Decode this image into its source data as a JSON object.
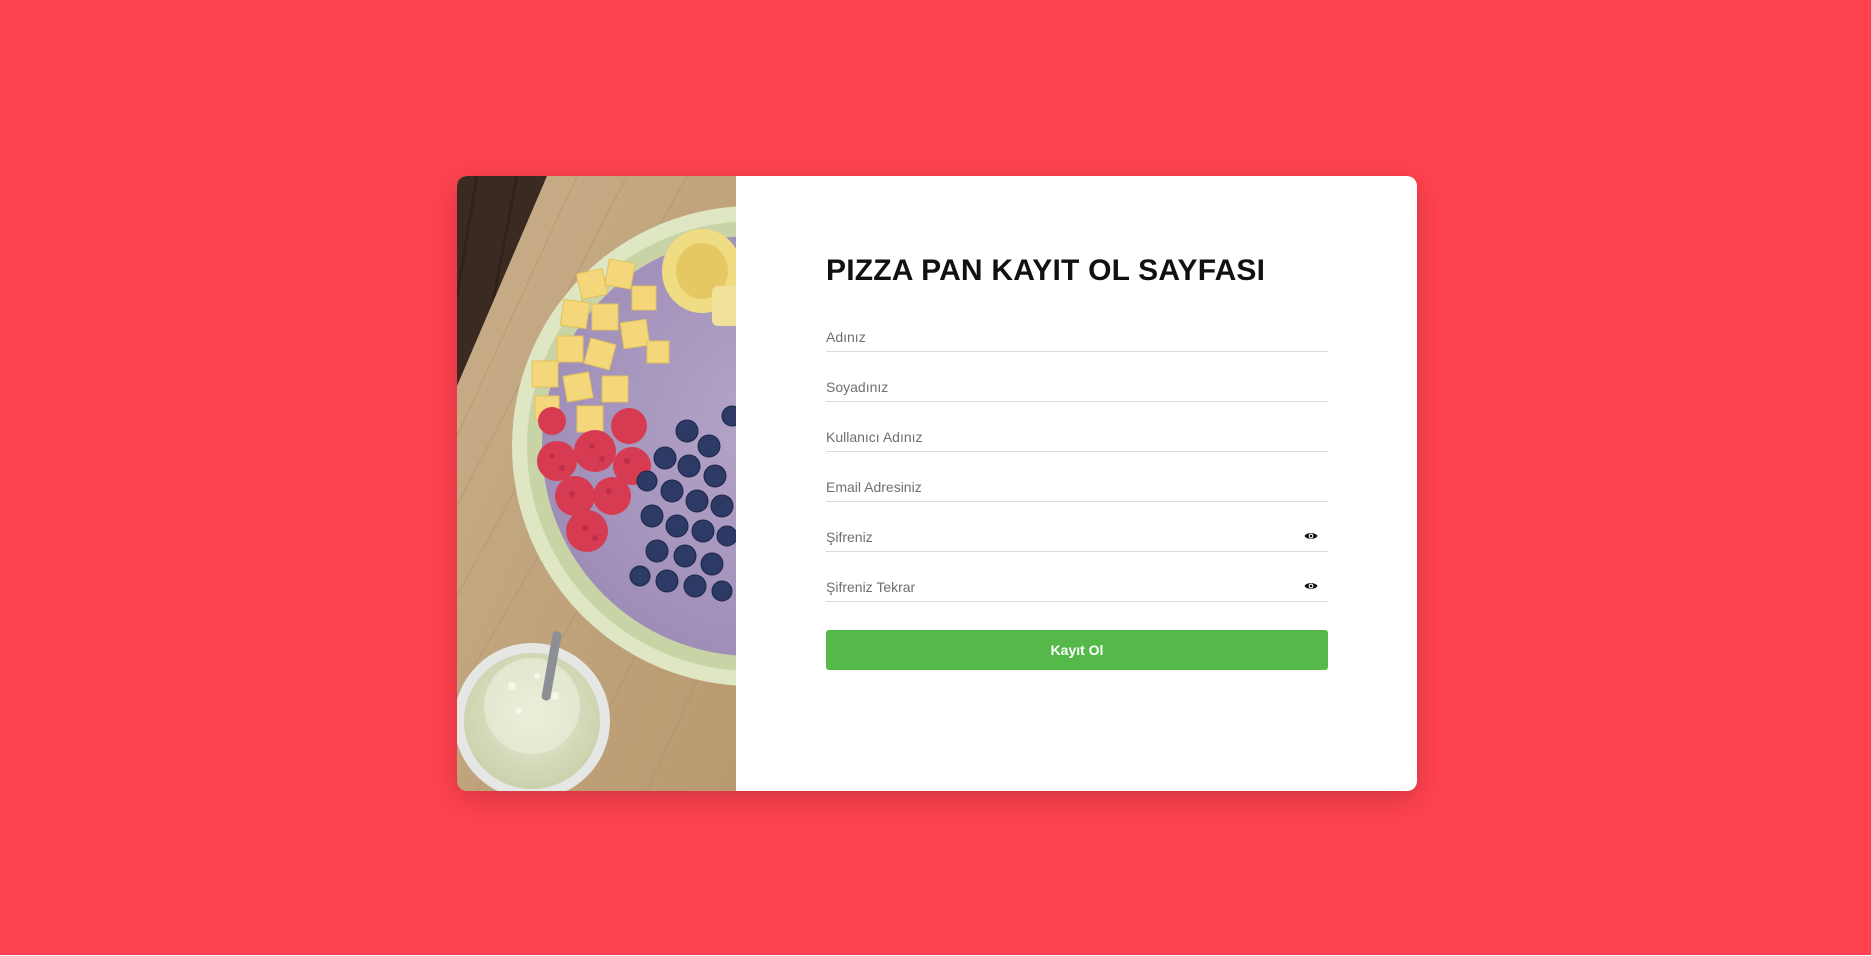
{
  "page": {
    "background_color": "#ff424f",
    "title": "PIZZA PAN KAYIT OL SAYFASI"
  },
  "photo": {
    "description_icon": "fruit-bowl-photo"
  },
  "form": {
    "fields": [
      {
        "name": "first-name-field",
        "placeholder": "Adınız",
        "type": "text"
      },
      {
        "name": "last-name-field",
        "placeholder": "Soyadınız",
        "type": "text"
      },
      {
        "name": "username-field",
        "placeholder": "Kullanıcı Adınız",
        "type": "text"
      },
      {
        "name": "email-field",
        "placeholder": "Email Adresiniz",
        "type": "email"
      },
      {
        "name": "password-field",
        "placeholder": "Şifreniz",
        "type": "password",
        "icon": "eye-icon"
      },
      {
        "name": "password-confirm-field",
        "placeholder": "Şifreniz Tekrar",
        "type": "password",
        "icon": "eye-icon"
      }
    ],
    "submit_label": "Kayıt Ol",
    "submit_color": "#55b949"
  }
}
